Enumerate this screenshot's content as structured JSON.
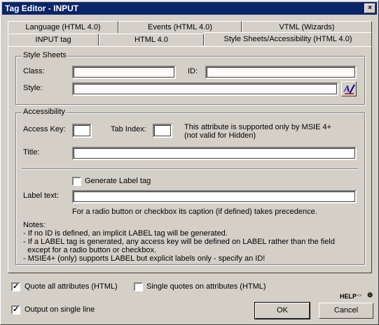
{
  "window": {
    "title": "Tag Editor - INPUT",
    "close_glyph": "×"
  },
  "tabs_back": [
    {
      "label": "Language (HTML 4.0)"
    },
    {
      "label": "Events (HTML 4.0)"
    },
    {
      "label": "VTML (Wizards)"
    }
  ],
  "tabs_front": [
    {
      "label": "INPUT tag"
    },
    {
      "label": "HTML 4.0"
    },
    {
      "label": "Style Sheets/Accessibility (HTML 4.0)"
    }
  ],
  "style_sheets": {
    "legend": "Style Sheets",
    "class_label": "Class:",
    "class_value": "",
    "id_label": "ID:",
    "id_value": "",
    "style_label": "Style:",
    "style_value": "",
    "style_button_icon": "style-editor-icon"
  },
  "accessibility": {
    "legend": "Accessibility",
    "access_key_label": "Access Key:",
    "access_key_value": "",
    "tab_index_label": "Tab Index:",
    "tab_index_value": "",
    "msie_note_line1": "This attribute is supported only by MSIE 4+",
    "msie_note_line2": "(not valid for Hidden)",
    "title_label": "Title:",
    "title_value": "",
    "generate_label_text": "Generate Label tag",
    "generate_label_checked": false,
    "label_text_label": "Label text:",
    "label_text_value": "",
    "radio_note": "For a radio button or checkbox its caption (if defined) takes precedence.",
    "notes": [
      "Notes:",
      "- If no ID is defined, an implicit LABEL tag will be generated.",
      "- If a LABEL tag is generated, any access key will be defined on LABEL rather than the field",
      "  except for a radio button or checkbox.",
      "- MSIE4+ (only) supports LABEL but explicit labels only - specify an ID!"
    ]
  },
  "footer": {
    "quote_all_label": "Quote all attributes (HTML)",
    "quote_all_checked": true,
    "single_quotes_label": "Single quotes on attributes (HTML)",
    "single_quotes_checked": false,
    "single_line_label": "Output on single line",
    "single_line_checked": true,
    "help_label": "HELP",
    "ok_label": "OK",
    "cancel_label": "Cancel"
  },
  "check_glyph": "✓"
}
